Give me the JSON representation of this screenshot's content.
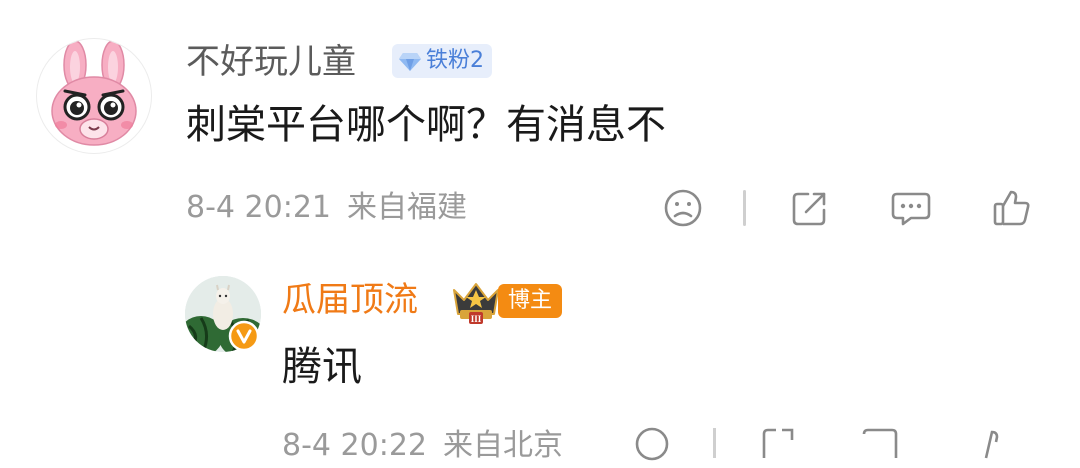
{
  "comment": {
    "username": "不好玩儿童",
    "fan_badge": "铁粉2",
    "text": "刺棠平台哪个啊？有消息不",
    "date": "8-4 20:21",
    "location": "来自福建"
  },
  "reply": {
    "username": "瓜届顶流",
    "badge": "博主",
    "text": "腾讯"
  },
  "next": {
    "date": "8-4 20:22",
    "location": "来自北京"
  },
  "colors": {
    "username_gray": "#5b5b5b",
    "reply_username": "#f07a16",
    "badge_orange": "#f48b12",
    "fan_badge_bg": "#e7eefb",
    "fan_badge_text": "#4a7fd8",
    "meta_gray": "#9a9a9a"
  }
}
